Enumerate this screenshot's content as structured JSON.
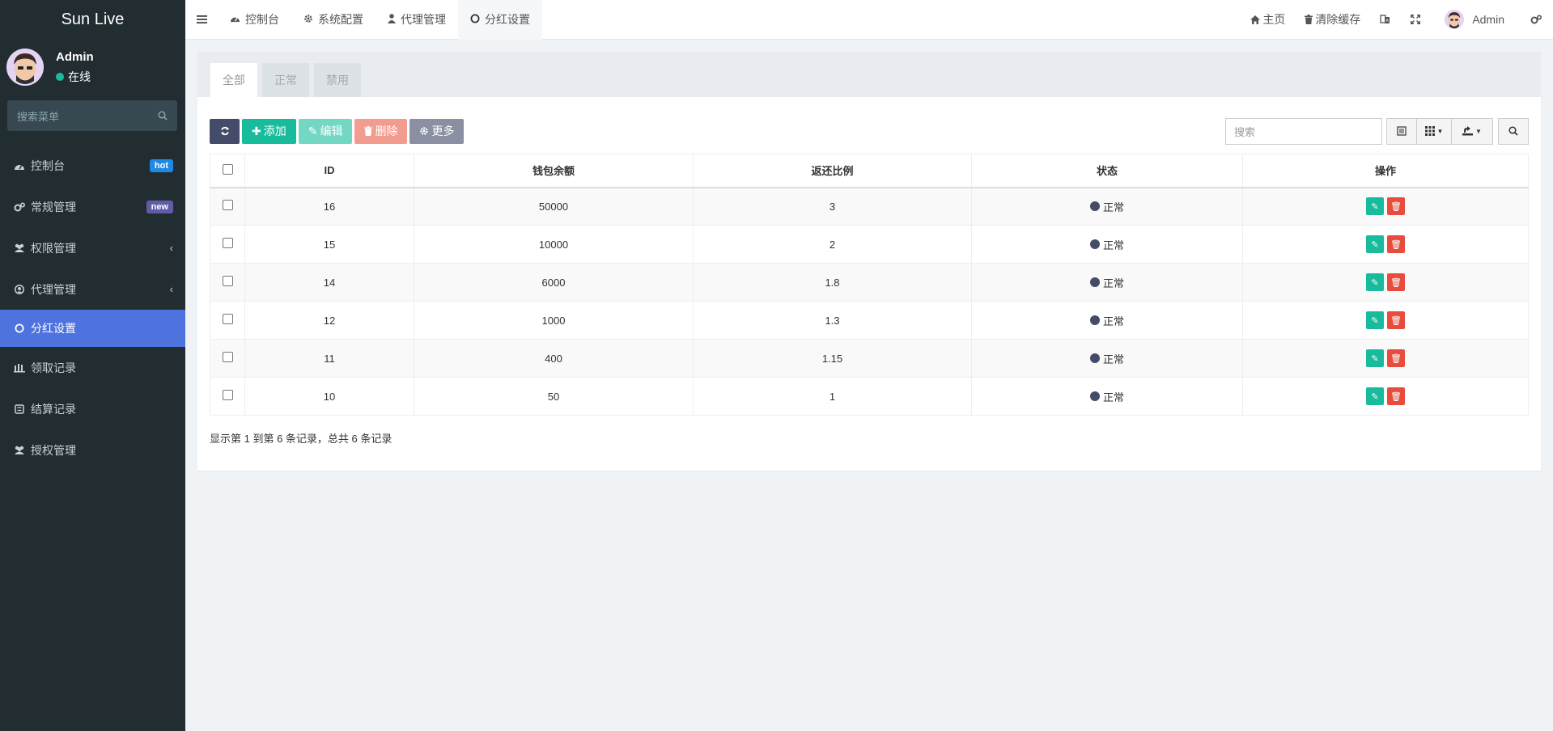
{
  "app": {
    "title": "Sun Live"
  },
  "user": {
    "name": "Admin",
    "status": "在线"
  },
  "sidebar": {
    "search_placeholder": "搜索菜单",
    "items": [
      {
        "label": "控制台",
        "icon": "dashboard-icon",
        "badge": "hot"
      },
      {
        "label": "常规管理",
        "icon": "cogs-icon",
        "badge": "new"
      },
      {
        "label": "权限管理",
        "icon": "group-icon",
        "chevron": true
      },
      {
        "label": "代理管理",
        "icon": "user-circle-icon",
        "chevron": true
      },
      {
        "label": "分红设置",
        "icon": "circle-icon",
        "active": true
      },
      {
        "label": "领取记录",
        "icon": "list-icon"
      },
      {
        "label": "结算记录",
        "icon": "calculator-icon"
      },
      {
        "label": "授权管理",
        "icon": "group-icon"
      }
    ]
  },
  "topnav": {
    "tabs": [
      {
        "label": "控制台",
        "icon": "dashboard-icon"
      },
      {
        "label": "系统配置",
        "icon": "gear-icon"
      },
      {
        "label": "代理管理",
        "icon": "user-icon"
      },
      {
        "label": "分红设置",
        "icon": "circle-icon",
        "active": true
      }
    ],
    "home": "主页",
    "clear_cache": "清除缓存",
    "user": "Admin"
  },
  "panel": {
    "tabs": [
      "全部",
      "正常",
      "禁用"
    ],
    "toolbar": {
      "add": "添加",
      "edit": "编辑",
      "delete": "删除",
      "more": "更多"
    },
    "search_placeholder": "搜索"
  },
  "table": {
    "columns": [
      "ID",
      "钱包余额",
      "返还比例",
      "状态",
      "操作"
    ],
    "rows": [
      {
        "id": "16",
        "balance": "50000",
        "ratio": "3",
        "status": "正常"
      },
      {
        "id": "15",
        "balance": "10000",
        "ratio": "2",
        "status": "正常"
      },
      {
        "id": "14",
        "balance": "6000",
        "ratio": "1.8",
        "status": "正常"
      },
      {
        "id": "12",
        "balance": "1000",
        "ratio": "1.3",
        "status": "正常"
      },
      {
        "id": "11",
        "balance": "400",
        "ratio": "1.15",
        "status": "正常"
      },
      {
        "id": "10",
        "balance": "50",
        "ratio": "1",
        "status": "正常"
      }
    ]
  },
  "pagination": {
    "text": "显示第 1 到第 6 条记录，总共 6 条记录"
  },
  "colors": {
    "sidebar_bg": "#222d32",
    "accent": "#4e73df",
    "success": "#18bc9c",
    "danger": "#e74c3c"
  }
}
